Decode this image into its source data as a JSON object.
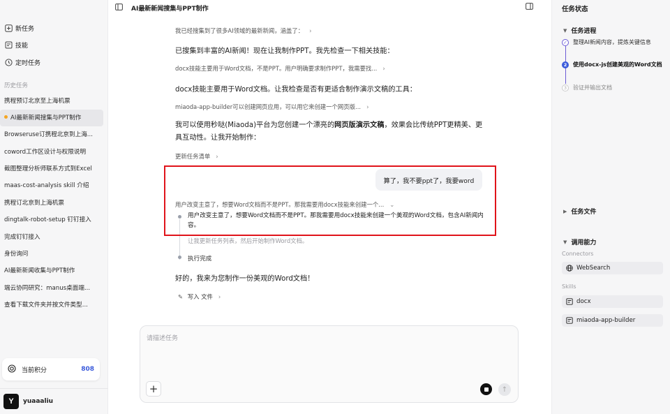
{
  "app": {
    "title": "AI最新新闻搜集与PPT制作"
  },
  "sidebar": {
    "top_items": [
      {
        "label": "新任务",
        "icon": "new-task-icon"
      },
      {
        "label": "技能",
        "icon": "skills-icon"
      },
      {
        "label": "定时任务",
        "icon": "clock-icon"
      }
    ],
    "history_label": "历史任务",
    "history": [
      "携程预订北京至上海机票",
      "AI最新新闻搜集与PPT制作",
      "Browseruse订携程北京到上海...",
      "coword工作区设计与权限说明",
      "截图整理分析师联系方式到Excel",
      "maas-cost-analysis skill 介绍",
      "携程订北京到上海机票",
      "dingtalk-robot-setup 钉钉接入",
      "完成钉钉接入",
      "身份询问",
      "AI最新新闻收集与PPT制作",
      "端云协同研究：manus桌面端...",
      "查看下载文件夹并按文件类型..."
    ],
    "active_index": 1,
    "credits_label": "当前积分",
    "credits_value": "808",
    "user_initial": "Y",
    "user_name": "yuaaaliu"
  },
  "chat": {
    "line1": "我已经搜集到了很多AI领域的最新新闻，涵盖了：",
    "line2": "已搜集到丰富的AI新闻！现在让我制作PPT。我先检查一下相关技能：",
    "line3": "docx技能主要用于Word文档，不是PPT。用户明确要求制作PPT，我需要找...",
    "line4": "docx技能主要用于Word文档。让我检查是否有更适合制作演示文稿的工具：",
    "line5": "miaoda-app-builder可以创建网页应用，可以用它来创建一个网页版...",
    "para_pre": "我可以使用秒哒(Miaoda)平台为您创建一个漂亮的",
    "para_bold": "网页版演示文稿",
    "para_post": "，效果会比传统PPT更精美、更具互动性。让我开始制作：",
    "update_label": "更新任务清单",
    "user_message": "算了，我不要ppt了，我要word",
    "think_collapsed": "用户改变主意了，想要Word文档而不是PPT。那我需要用docx技能来创建一个...",
    "think_expanded": "用户改变主意了，想要Word文档而不是PPT。那我需要用docx技能来创建一个美观的Word文档，包含AI新闻内容。",
    "think_next": "让我更新任务列表，然后开始制作Word文档。",
    "exec_done": "执行完成",
    "reply": "好的，我来为您制作一份美观的Word文档！",
    "write_label": "写入 文件"
  },
  "composer": {
    "placeholder": "请描述任务"
  },
  "right_panel": {
    "title": "任务状态",
    "progress_label": "任务进程",
    "steps": [
      {
        "num": "✓",
        "label": "整理AI新闻内容，提炼关键信息",
        "state": "done"
      },
      {
        "num": "2",
        "label": "使用docx-js创建美观的Word文档",
        "state": "active"
      },
      {
        "num": "3",
        "label": "验证并输出文档",
        "state": "pending"
      }
    ],
    "files_label": "任务文件",
    "capabilities_label": "调用能力",
    "connectors_label": "Connectors",
    "connectors": [
      "WebSearch"
    ],
    "skills_label": "Skills",
    "skills": [
      "docx",
      "miaoda-app-builder"
    ]
  },
  "colors": {
    "accent": "#3b5bdb",
    "highlight_box": "#e0131a",
    "active_dot": "#f5a623"
  }
}
